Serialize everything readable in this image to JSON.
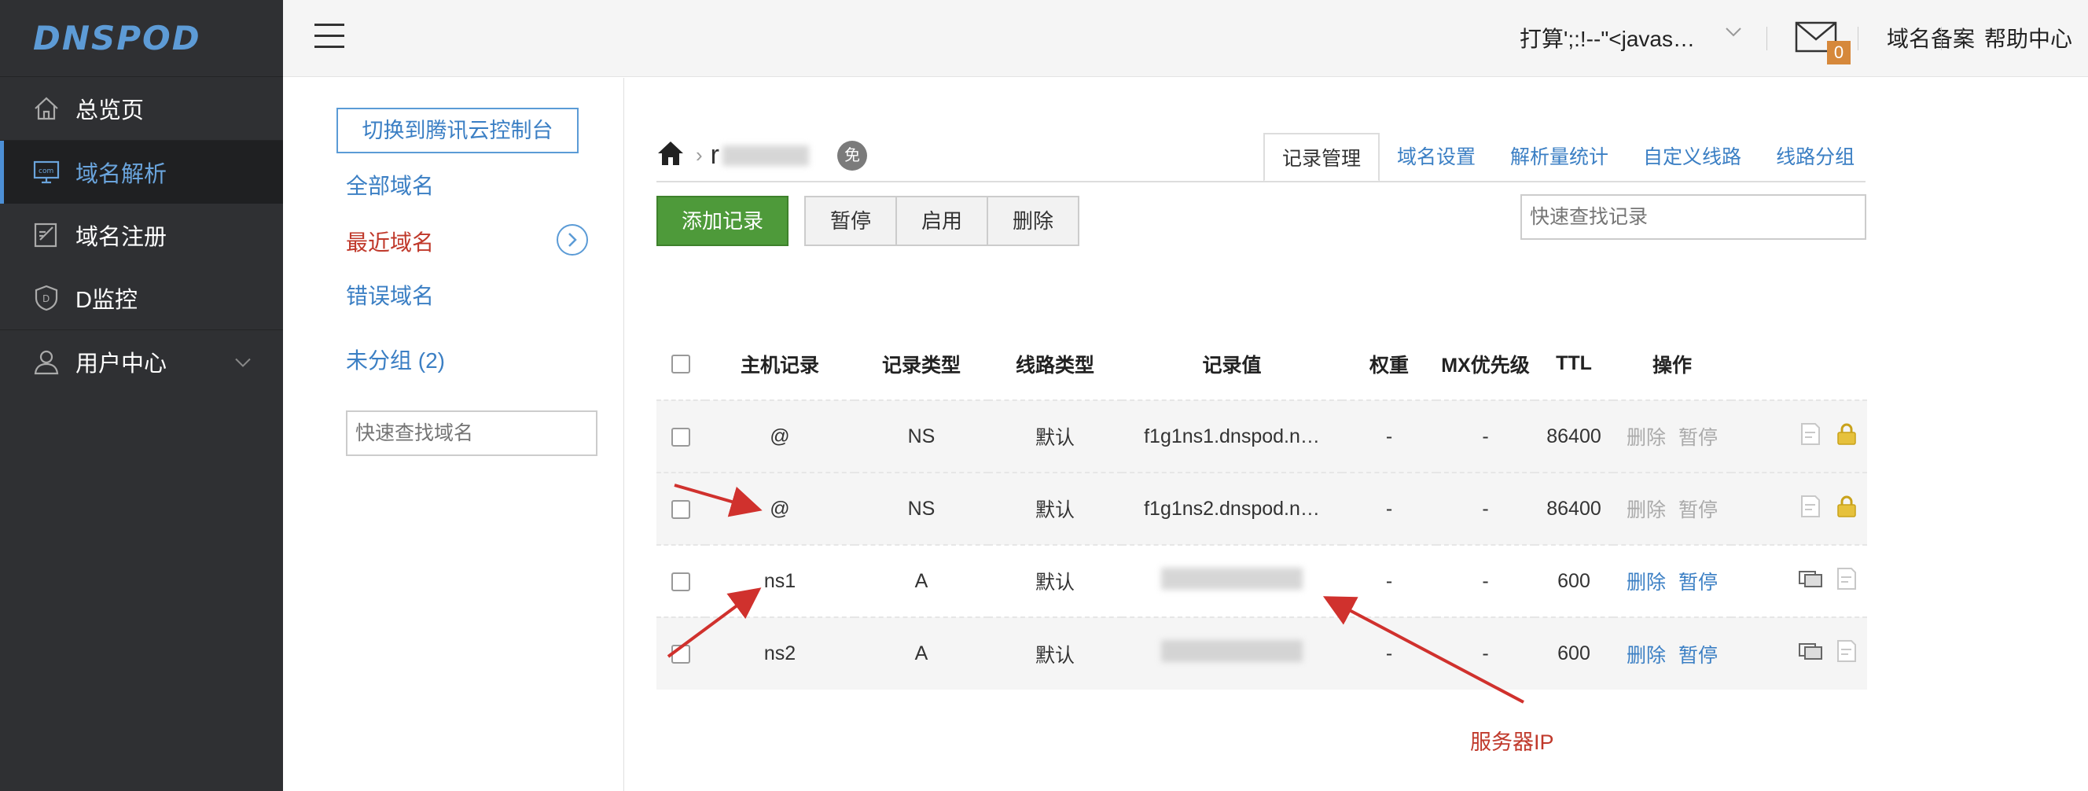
{
  "brand": {
    "logo": "DNSPOD"
  },
  "sidebar": {
    "items": [
      {
        "label": "总览页",
        "icon": "home-outline-icon"
      },
      {
        "label": "域名解析",
        "icon": "dns-monitor-icon",
        "active": true
      },
      {
        "label": "域名注册",
        "icon": "register-edit-icon"
      },
      {
        "label": "D监控",
        "icon": "shield-d-icon"
      },
      {
        "label": "用户中心",
        "icon": "user-icon",
        "expandable": true
      }
    ]
  },
  "header": {
    "user_name": "打算';:!--\"<javas…",
    "mail_count": "0",
    "links": [
      "域名备案",
      "帮助中心"
    ]
  },
  "domain_panel": {
    "switch_button": "切换到腾讯云控制台",
    "all_domains": "全部域名",
    "recent_domains": "最近域名",
    "error_domains": "错误域名",
    "ungrouped": "未分组 (2)",
    "search_placeholder": "快速查找域名"
  },
  "main": {
    "breadcrumb_domain": "r",
    "free_badge": "免",
    "tabs": [
      "记录管理",
      "域名设置",
      "解析量统计",
      "自定义线路",
      "线路分组"
    ],
    "active_tab": 0,
    "buttons": {
      "add": "添加记录",
      "pause": "暂停",
      "enable": "启用",
      "delete": "删除"
    },
    "record_search_placeholder": "快速查找记录",
    "columns": [
      "主机记录",
      "记录类型",
      "线路类型",
      "记录值",
      "权重",
      "MX优先级",
      "TTL",
      "操作"
    ],
    "rows": [
      {
        "host": "@",
        "type": "NS",
        "line": "默认",
        "value": "f1g1ns1.dnspod.n…",
        "weight": "-",
        "mx": "-",
        "ttl": "86400",
        "delete": "删除",
        "pause": "暂停",
        "enabled_actions": false
      },
      {
        "host": "@",
        "type": "NS",
        "line": "默认",
        "value": "f1g1ns2.dnspod.n…",
        "weight": "-",
        "mx": "-",
        "ttl": "86400",
        "delete": "删除",
        "pause": "暂停",
        "enabled_actions": false
      },
      {
        "host": "ns1",
        "type": "A",
        "line": "默认",
        "value": "",
        "weight": "-",
        "mx": "-",
        "ttl": "600",
        "delete": "删除",
        "pause": "暂停",
        "enabled_actions": true
      },
      {
        "host": "ns2",
        "type": "A",
        "line": "默认",
        "value": "",
        "weight": "-",
        "mx": "-",
        "ttl": "600",
        "delete": "删除",
        "pause": "暂停",
        "enabled_actions": true
      }
    ]
  },
  "annotation": {
    "label": "服务器IP",
    "color": "#c0392b"
  },
  "colors": {
    "accent": "#3b7fc4",
    "add_button": "#4e9a3a",
    "sidebar_bg": "#2f3033",
    "badge": "#d6883b"
  }
}
